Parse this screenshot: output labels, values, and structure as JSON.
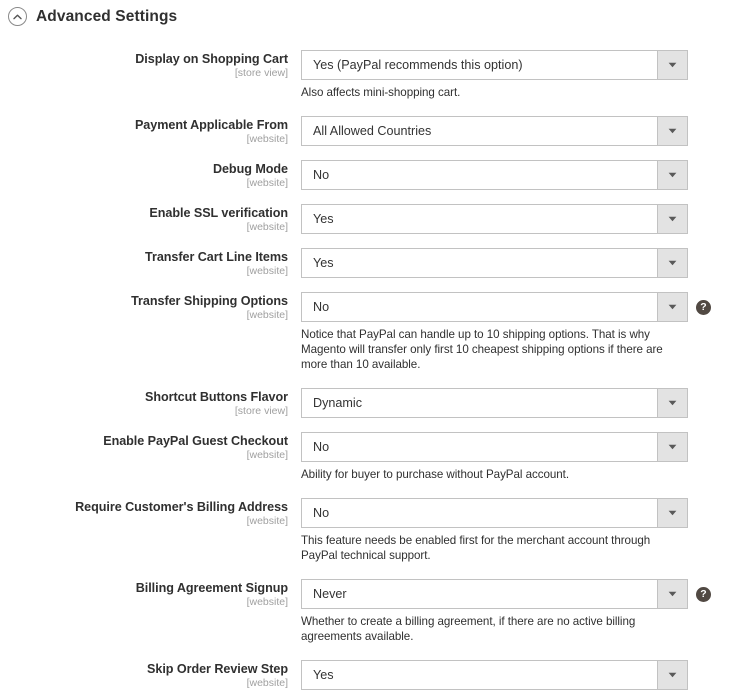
{
  "section": {
    "title": "Advanced Settings",
    "collapse_icon": "chevron-up-circle-icon"
  },
  "icons": {
    "dropdown": "chevron-down-icon",
    "help": "help-question-icon",
    "help_glyph": "?"
  },
  "fields": [
    {
      "label": "Display on Shopping Cart",
      "scope": "[store view]",
      "value": "Yes (PayPal recommends this option)",
      "note": "Also affects mini-shopping cart.",
      "help": false,
      "gap_after": 16
    },
    {
      "label": "Payment Applicable From",
      "scope": "[website]",
      "value": "All Allowed Countries",
      "note": "",
      "help": false,
      "gap_after": 14
    },
    {
      "label": "Debug Mode",
      "scope": "[website]",
      "value": "No",
      "note": "",
      "help": false,
      "gap_after": 14
    },
    {
      "label": "Enable SSL verification",
      "scope": "[website]",
      "value": "Yes",
      "note": "",
      "help": false,
      "gap_after": 14
    },
    {
      "label": "Transfer Cart Line Items",
      "scope": "[website]",
      "value": "Yes",
      "note": "",
      "help": false,
      "gap_after": 14
    },
    {
      "label": "Transfer Shipping Options",
      "scope": "[website]",
      "value": "No",
      "note": "Notice that PayPal can handle up to 10 shipping options. That is why Magento will transfer only first 10 cheapest shipping options if there are more than 10 available.",
      "help": true,
      "gap_after": 16
    },
    {
      "label": "Shortcut Buttons Flavor",
      "scope": "[store view]",
      "value": "Dynamic",
      "note": "",
      "help": false,
      "gap_after": 14
    },
    {
      "label": "Enable PayPal Guest Checkout",
      "scope": "[website]",
      "value": "No",
      "note": "Ability for buyer to purchase without PayPal account.",
      "help": false,
      "gap_after": 16
    },
    {
      "label": "Require Customer's Billing Address",
      "scope": "[website]",
      "value": "No",
      "note": "This feature needs be enabled first for the merchant account through PayPal technical support.",
      "help": false,
      "gap_after": 16
    },
    {
      "label": "Billing Agreement Signup",
      "scope": "[website]",
      "value": "Never",
      "note": "Whether to create a billing agreement, if there are no active billing agreements available.",
      "help": true,
      "gap_after": 16
    },
    {
      "label": "Skip Order Review Step",
      "scope": "[website]",
      "value": "Yes",
      "note": "",
      "help": false,
      "gap_after": 14
    }
  ],
  "colors": {
    "text": "#303030",
    "scope_text": "#a0a0a0",
    "select_border": "#c2c2c2",
    "select_arrow_bg": "#e3e3e3",
    "help_bg": "#514943",
    "page_bg": "#ffffff"
  }
}
